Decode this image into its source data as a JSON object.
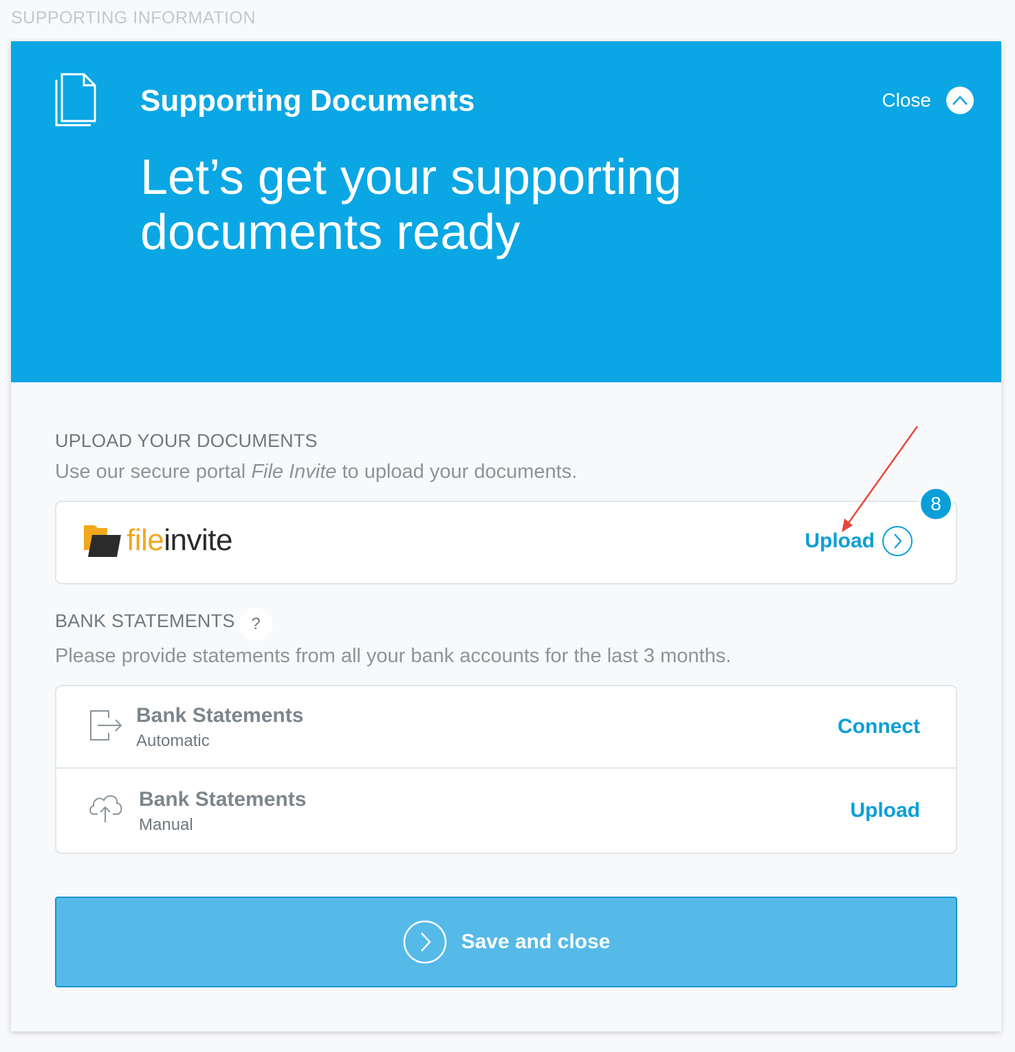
{
  "page": {
    "section_label": "SUPPORTING INFORMATION"
  },
  "header": {
    "title": "Supporting Documents",
    "close_label": "Close",
    "heading_line1": "Let’s get your supporting",
    "heading_line2": "documents ready"
  },
  "upload_section": {
    "label": "UPLOAD YOUR DOCUMENTS",
    "desc_before": "Use our secure portal ",
    "desc_em": "File Invite",
    "desc_after": " to upload your documents.",
    "logo_file": "file",
    "logo_invite": "invite",
    "action_label": "Upload",
    "badge": "8"
  },
  "bank_section": {
    "label": "BANK STATEMENTS",
    "help": "?",
    "desc": "Please provide statements from all your bank accounts for the last 3 months.",
    "rows": [
      {
        "title": "Bank Statements",
        "subtitle": "Automatic",
        "action": "Connect",
        "icon": "export-icon"
      },
      {
        "title": "Bank Statements",
        "subtitle": "Manual",
        "action": "Upload",
        "icon": "cloud-upload-icon"
      }
    ]
  },
  "footer": {
    "save_label": "Save and close"
  },
  "colors": {
    "accent": "#0aa7e4",
    "link": "#0a9fd8",
    "save_bg": "#55bae8",
    "brand_file": "#f0a81c"
  }
}
